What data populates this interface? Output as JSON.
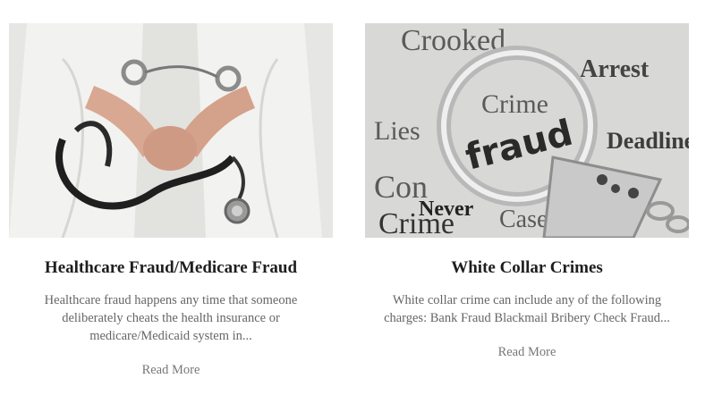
{
  "cards": [
    {
      "title": "Healthcare Fraud/Medicare Fraud",
      "excerpt": "Healthcare fraud happens any time that someone deliberately cheats the health insurance or medicare/Medicaid system in...",
      "read_more": "Read More",
      "image": "doctor-handcuffed-stethoscope"
    },
    {
      "title": "White Collar Crimes",
      "excerpt": "White collar crime can include any of the following charges: Bank Fraud Blackmail Bribery Check Fraud...",
      "read_more": "Read More",
      "image": "handcuffs-fraud-newspaper",
      "image_words": [
        "Crooked",
        "Crime",
        "fraud",
        "Arrest",
        "Con",
        "Lies",
        "Deadline",
        "Never",
        "Crime",
        "Cases"
      ]
    }
  ]
}
